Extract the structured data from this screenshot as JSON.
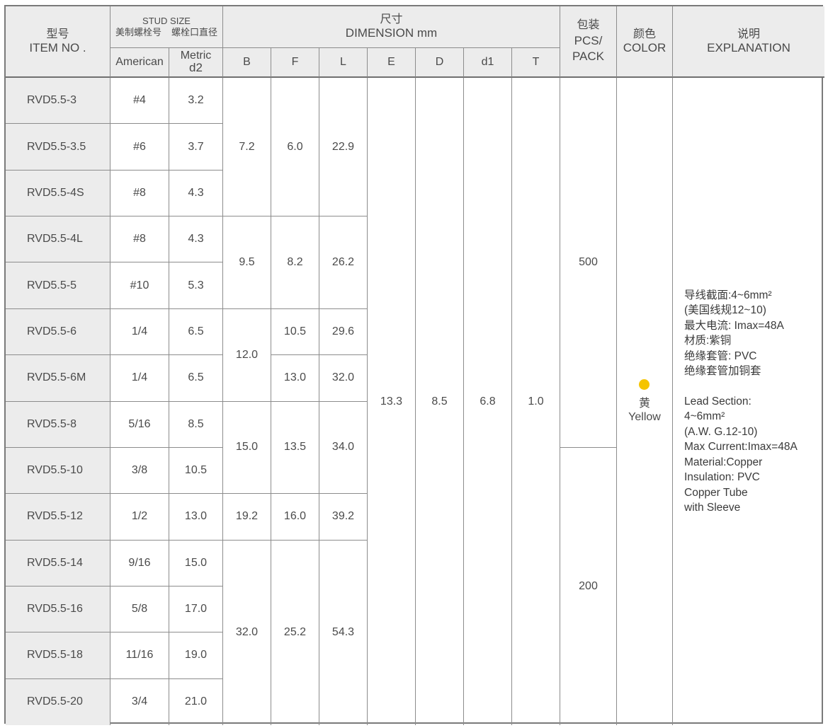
{
  "header": {
    "item_zh": "型号",
    "item_en": "ITEM NO .",
    "stud_title": "STUD SIZE",
    "stud_sub_american_zh": "美制螺栓号",
    "stud_sub_metric_zh": "螺栓口直径",
    "american": "American",
    "metric_line1": "Metric",
    "metric_line2": "d2",
    "dim_zh": "尺寸",
    "dim_en": "DIMENSION mm",
    "dim_cols": [
      "B",
      "F",
      "L",
      "E",
      "D",
      "d1",
      "T"
    ],
    "pack_zh": "包装",
    "pack_en1": "PCS/",
    "pack_en2": "PACK",
    "color_zh": "颜色",
    "color_en": "COLOR",
    "expl_zh": "说明",
    "expl_en": "EXPLANATION"
  },
  "rows": [
    {
      "item": "RVD5.5-3",
      "american": "#4",
      "metric": "3.2"
    },
    {
      "item": "RVD5.5-3.5",
      "american": "#6",
      "metric": "3.7"
    },
    {
      "item": "RVD5.5-4S",
      "american": "#8",
      "metric": "4.3"
    },
    {
      "item": "RVD5.5-4L",
      "american": "#8",
      "metric": "4.3"
    },
    {
      "item": "RVD5.5-5",
      "american": "#10",
      "metric": "5.3"
    },
    {
      "item": "RVD5.5-6",
      "american": "1/4",
      "metric": "6.5"
    },
    {
      "item": "RVD5.5-6M",
      "american": "1/4",
      "metric": "6.5"
    },
    {
      "item": "RVD5.5-8",
      "american": "5/16",
      "metric": "8.5"
    },
    {
      "item": "RVD5.5-10",
      "american": "3/8",
      "metric": "10.5"
    },
    {
      "item": "RVD5.5-12",
      "american": "1/2",
      "metric": "13.0"
    },
    {
      "item": "RVD5.5-14",
      "american": "9/16",
      "metric": "15.0"
    },
    {
      "item": "RVD5.5-16",
      "american": "5/8",
      "metric": "17.0"
    },
    {
      "item": "RVD5.5-18",
      "american": "11/16",
      "metric": "19.0"
    },
    {
      "item": "RVD5.5-20",
      "american": "3/4",
      "metric": "21.0"
    }
  ],
  "B": [
    "7.2",
    "9.5",
    "12.0",
    "15.0",
    "19.2",
    "32.0"
  ],
  "F": [
    "6.0",
    "8.2",
    "10.5",
    "13.0",
    "13.5",
    "16.0",
    "25.2"
  ],
  "L": [
    "22.9",
    "26.2",
    "29.6",
    "32.0",
    "34.0",
    "39.2",
    "54.3"
  ],
  "E": "13.3",
  "D": "8.5",
  "d1": "6.8",
  "T": "1.0",
  "pack": [
    "500",
    "200"
  ],
  "color": {
    "zh": "黄",
    "en": "Yellow",
    "dot_color": "#f5c400"
  },
  "explanation": {
    "zh_lines": [
      "导线截面:4~6mm²",
      "(美国线规12~10)",
      "最大电流: Imax=48A",
      "材质:紫铜",
      "绝缘套管: PVC",
      "绝缘套管加铜套"
    ],
    "en_lines": [
      "Lead Section:",
      "4~6mm²",
      "(A.W. G.12-10)",
      "Max Current:Imax=48A",
      "Material:Copper",
      "Insulation: PVC",
      "Copper Tube",
      "with Sleeve"
    ]
  }
}
